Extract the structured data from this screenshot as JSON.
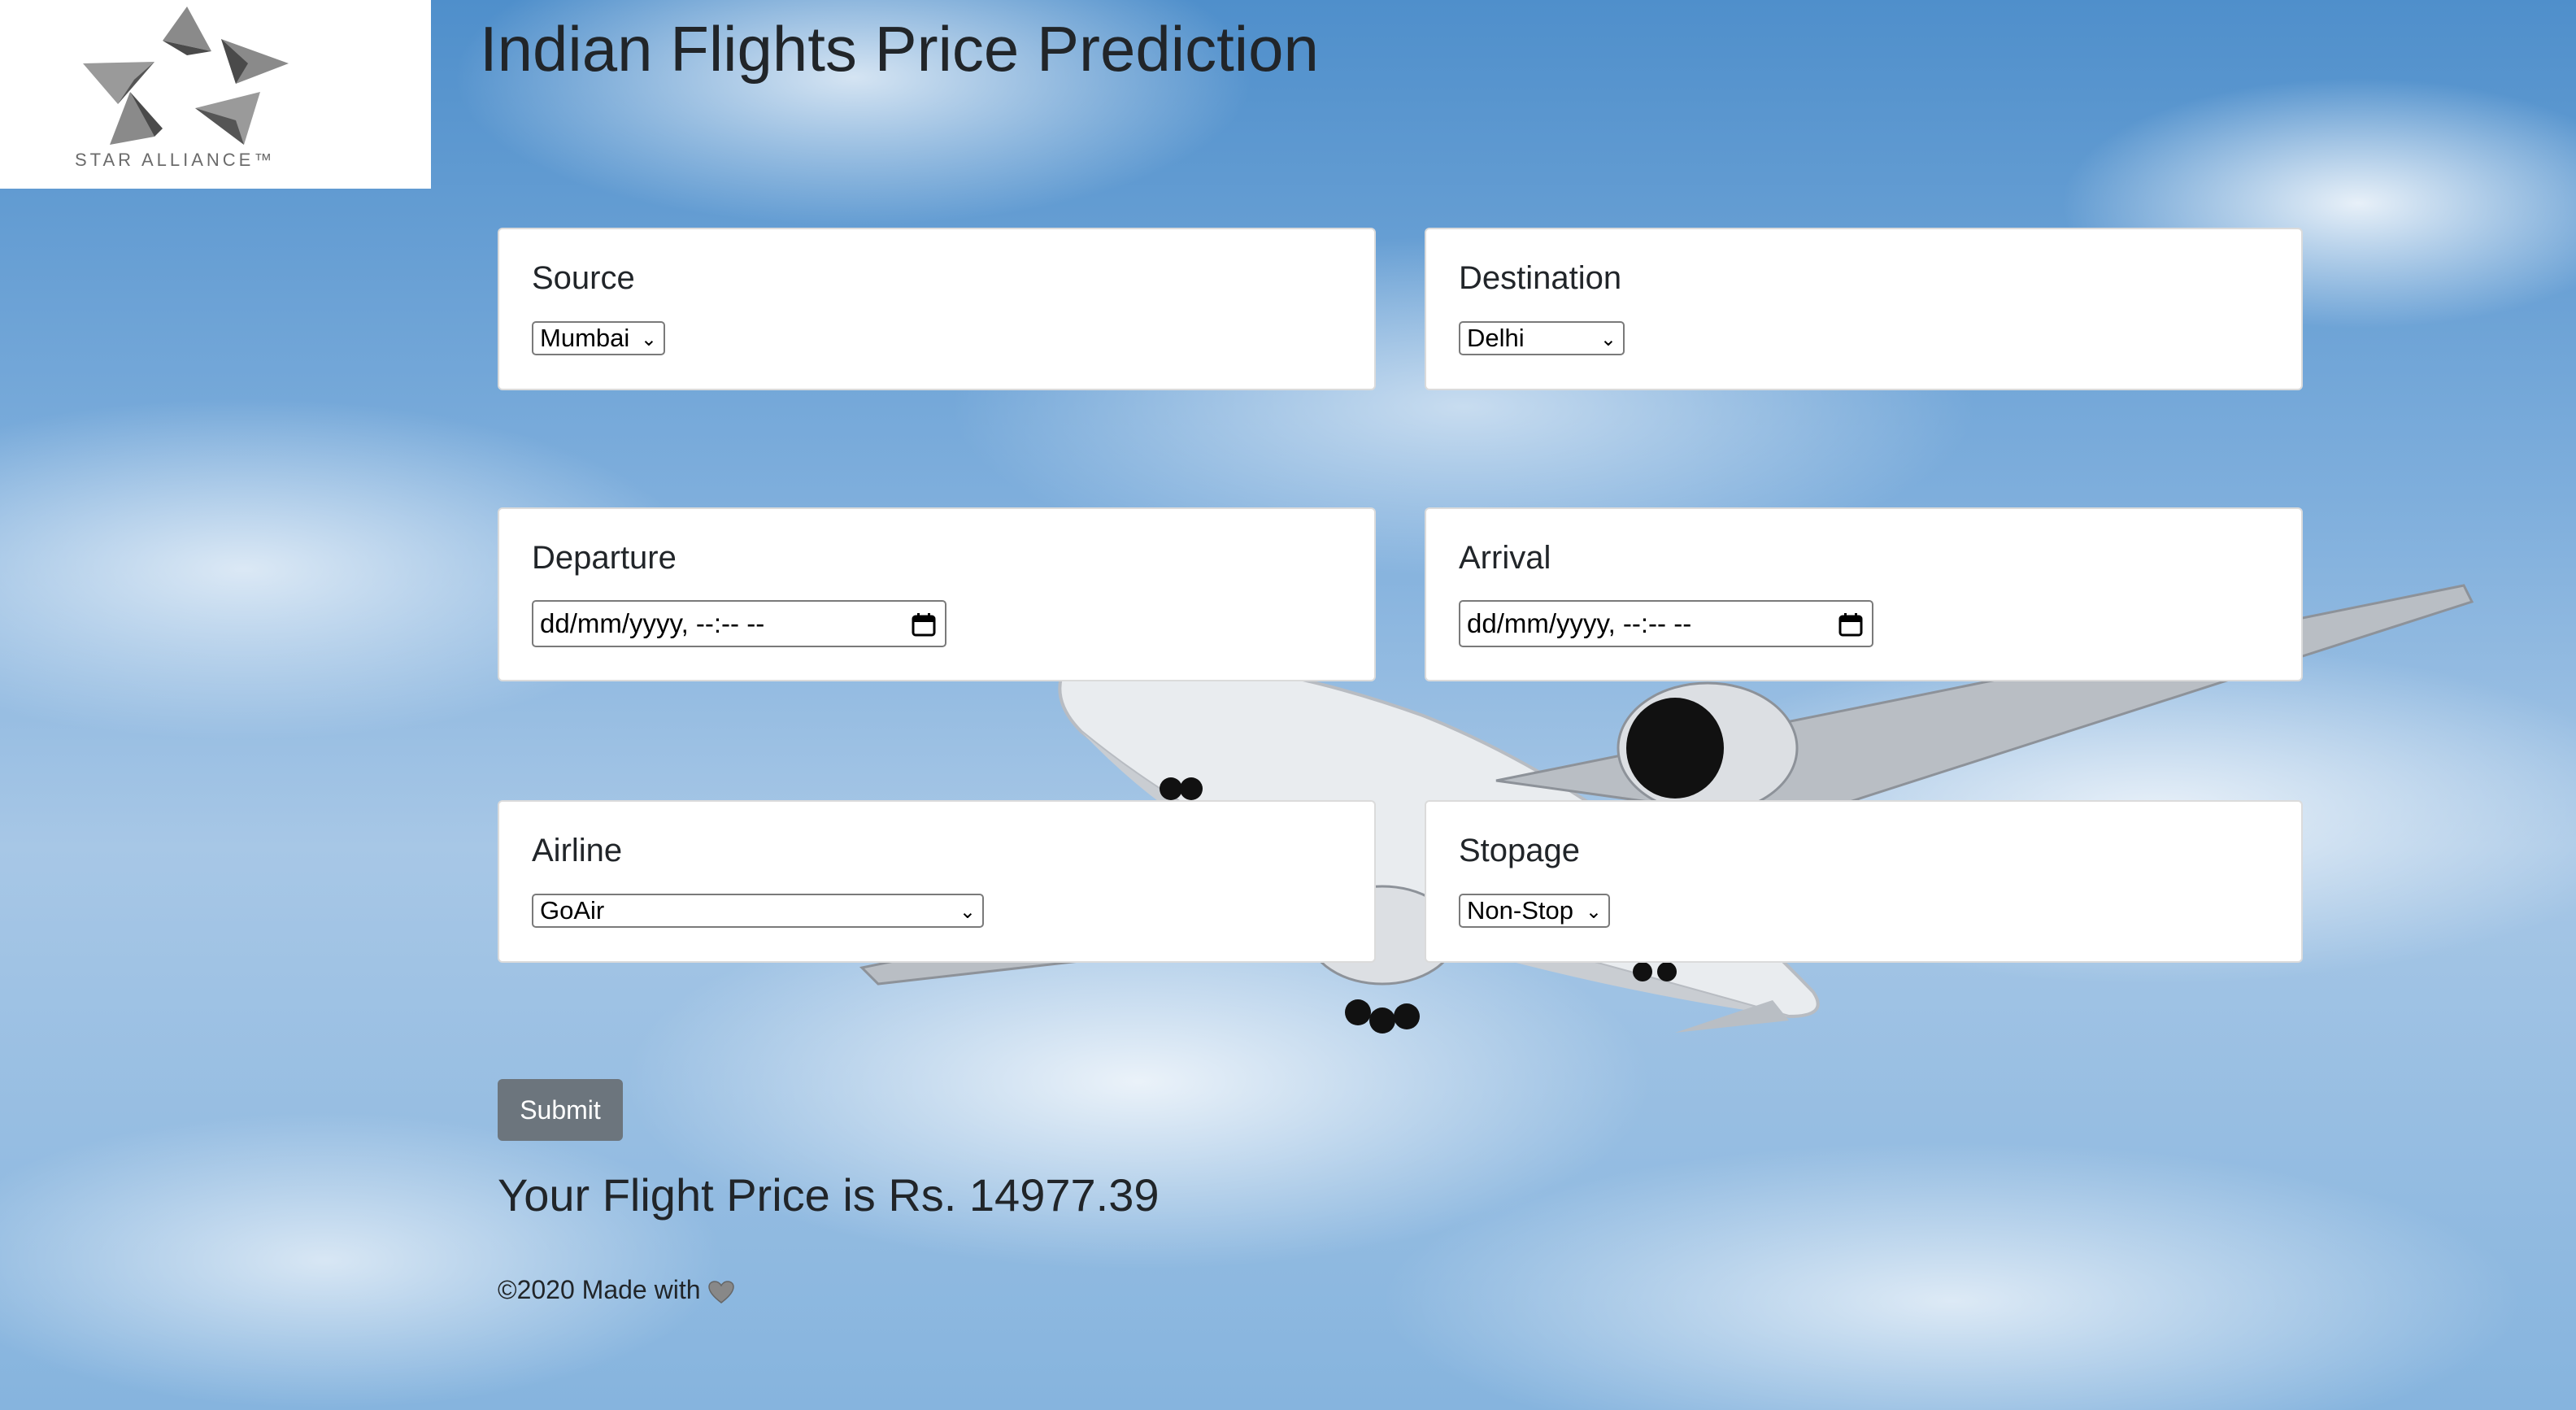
{
  "header": {
    "logo_text": "STAR ALLIANCE™",
    "title": "Indian Flights Price Prediction"
  },
  "form": {
    "source": {
      "label": "Source",
      "selected": "Mumbai"
    },
    "destination": {
      "label": "Destination",
      "selected": "Delhi"
    },
    "departure": {
      "label": "Departure",
      "placeholder": "dd/mm/yyyy, --:-- --"
    },
    "arrival": {
      "label": "Arrival",
      "placeholder": "dd/mm/yyyy, --:-- --"
    },
    "airline": {
      "label": "Airline",
      "selected": "GoAir"
    },
    "stopage": {
      "label": "Stopage",
      "selected": "Non-Stop"
    },
    "submit_label": "Submit"
  },
  "result": {
    "text": "Your Flight Price is Rs. 14977.39"
  },
  "footer": {
    "text": "©2020 Made with",
    "icon": "heart-icon"
  },
  "colors": {
    "submit_button": "#6c757d",
    "card_background": "#ffffff",
    "title_text": "#212529"
  }
}
